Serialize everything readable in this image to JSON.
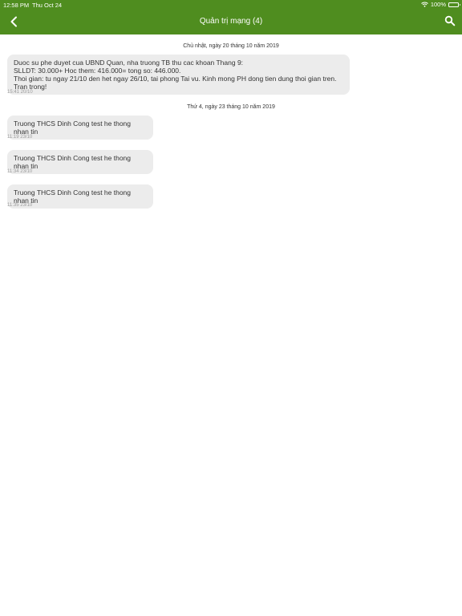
{
  "status": {
    "time": "12:58 PM",
    "date": "Thu Oct 24",
    "battery": "100%"
  },
  "nav": {
    "title": "Quản trị mạng (4)"
  },
  "days": [
    {
      "header": "Chủ nhật, ngày 20 tháng 10 năm 2019"
    },
    {
      "header": "Thứ 4, ngày 23 tháng 10 năm 2019"
    }
  ],
  "messages": [
    {
      "text": "Duoc su phe duyet cua UBND Quan, nha truong TB thu cac khoan Thang 9:\nSLLDT: 30.000+ Hoc them: 416.000= tong so: 446.000.\nThoi gian: tu ngay 21/10 den het ngay 26/10, tai phong Tai vu. Kinh mong PH dong tien dung thoi gian tren. Tran trong!",
      "time": "15:41 20/10"
    },
    {
      "text": "Truong THCS Dinh Cong test he thong nhan tin",
      "time": "11:19 23/10"
    },
    {
      "text": "Truong THCS Dinh Cong test he thong nhan tin",
      "time": "11:34 23/10"
    },
    {
      "text": "Truong THCS Dinh Cong test he thong nhan tin",
      "time": "11:35 23/10"
    }
  ],
  "colors": {
    "header_bg": "#4f8d1f",
    "bubble_bg": "#ececec"
  }
}
